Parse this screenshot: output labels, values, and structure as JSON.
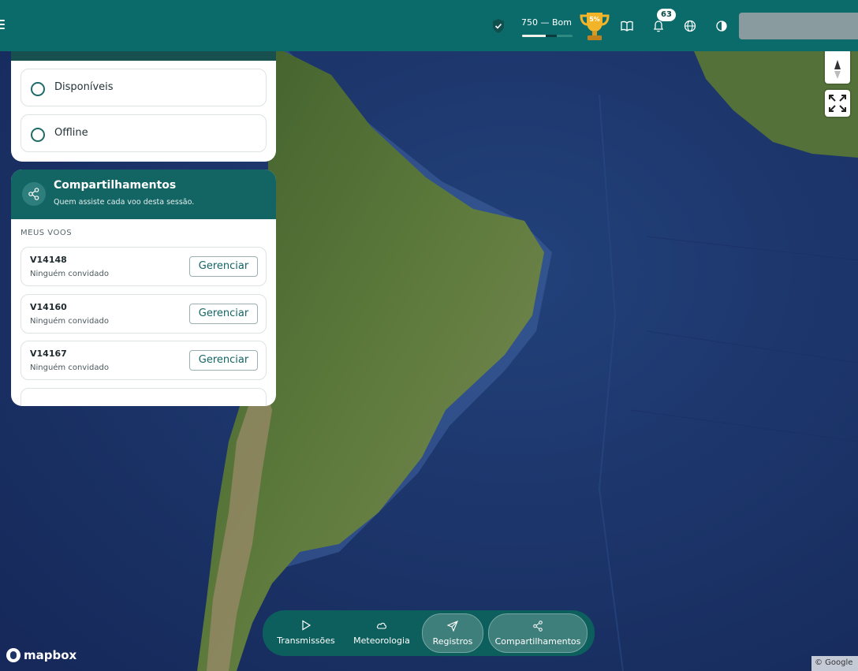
{
  "header": {
    "score_text": "750 — Bom",
    "score_progress": 0.6,
    "trophy_label": "5%",
    "notifications_count": "63",
    "icons": [
      "menu-icon",
      "shield-check-icon",
      "trophy-icon",
      "book-icon",
      "bell-icon",
      "globe-icon",
      "contrast-icon"
    ]
  },
  "status_filters": [
    {
      "label": "Disponíveis"
    },
    {
      "label": "Offline"
    }
  ],
  "sharing": {
    "title": "Compartilhamentos",
    "subtitle": "Quem assiste cada voo desta sessão.",
    "section_label": "MEUS VOOS",
    "flights": [
      {
        "code": "V14148",
        "status": "Ninguém convidado",
        "action": "Gerenciar"
      },
      {
        "code": "V14160",
        "status": "Ninguém convidado",
        "action": "Gerenciar"
      },
      {
        "code": "V14167",
        "status": "Ninguém convidado",
        "action": "Gerenciar"
      }
    ]
  },
  "bottom_nav": [
    {
      "label": "Transmissões",
      "icon": "play-icon",
      "active": false
    },
    {
      "label": "Meteorologia",
      "icon": "cloud-icon",
      "active": false
    },
    {
      "label": "Registros",
      "icon": "send-icon",
      "active": true
    },
    {
      "label": "Compartilhamentos",
      "icon": "share-icon",
      "active": true
    }
  ],
  "map": {
    "attribution_logo": "mapbox",
    "attribution_credit": "© Google",
    "colors": {
      "ocean": "#1e3566",
      "land": "#4f6e34",
      "topbar": "#0b6b6a"
    }
  }
}
